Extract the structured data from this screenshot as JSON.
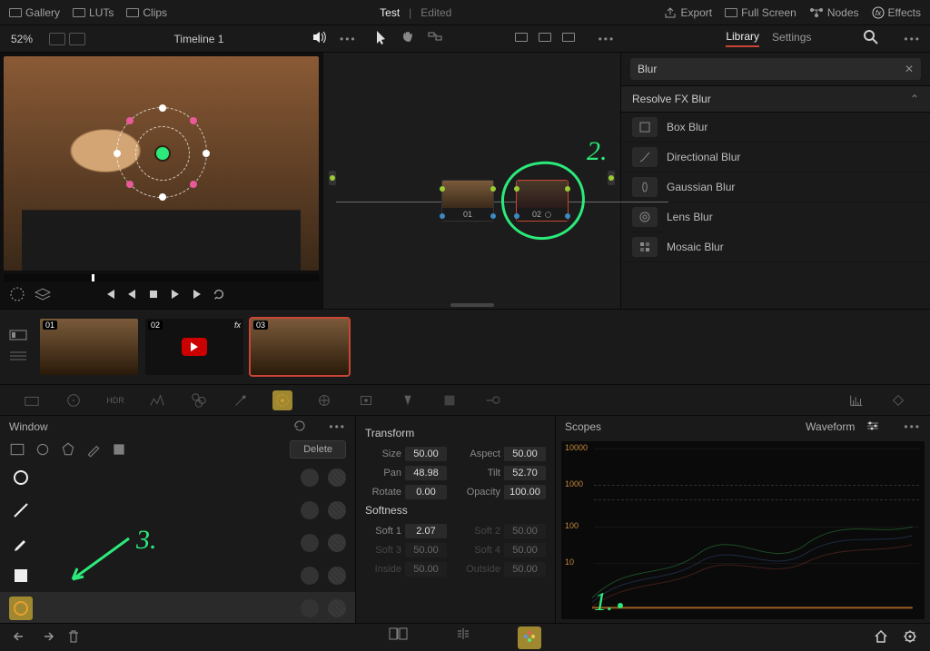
{
  "topbar": {
    "gallery": "Gallery",
    "luts": "LUTs",
    "clips": "Clips",
    "title": "Test",
    "edited": "Edited",
    "export": "Export",
    "fullscreen": "Full Screen",
    "nodes": "Nodes",
    "effects": "Effects"
  },
  "secondbar": {
    "zoom": "52%",
    "timeline": "Timeline 1"
  },
  "library": {
    "tabs": {
      "library": "Library",
      "settings": "Settings"
    },
    "search_value": "Blur",
    "section_title": "Resolve FX Blur",
    "items": [
      {
        "label": "Box Blur"
      },
      {
        "label": "Directional Blur"
      },
      {
        "label": "Gaussian Blur"
      },
      {
        "label": "Lens Blur"
      },
      {
        "label": "Mosaic Blur"
      }
    ]
  },
  "nodes": {
    "n1": "01",
    "n2": "02"
  },
  "clips": {
    "c1": "01",
    "c2": "02",
    "c3": "03",
    "fx": "fx"
  },
  "window_panel": {
    "title": "Window",
    "delete": "Delete"
  },
  "transform": {
    "title": "Transform",
    "size_lbl": "Size",
    "size_val": "50.00",
    "aspect_lbl": "Aspect",
    "aspect_val": "50.00",
    "pan_lbl": "Pan",
    "pan_val": "48.98",
    "tilt_lbl": "Tilt",
    "tilt_val": "52.70",
    "rotate_lbl": "Rotate",
    "rotate_val": "0.00",
    "opacity_lbl": "Opacity",
    "opacity_val": "100.00",
    "softness_title": "Softness",
    "soft1_lbl": "Soft 1",
    "soft1_val": "2.07",
    "soft2_lbl": "Soft 2",
    "soft2_val": "50.00",
    "soft3_lbl": "Soft 3",
    "soft3_val": "50.00",
    "soft4_lbl": "Soft 4",
    "soft4_val": "50.00",
    "inside_lbl": "Inside",
    "inside_val": "50.00",
    "outside_lbl": "Outside",
    "outside_val": "50.00"
  },
  "scopes": {
    "title": "Scopes",
    "mode": "Waveform",
    "ticks": [
      "10000",
      "1000",
      "100",
      "10"
    ]
  },
  "annotations": {
    "a1": "1.",
    "a2": "2.",
    "a3": "3."
  }
}
